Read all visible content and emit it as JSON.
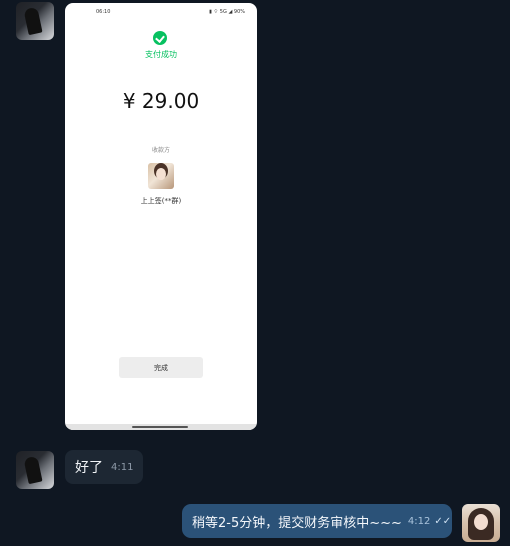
{
  "phone": {
    "status_time": "06:10",
    "status_right": "▮ ⌔ 5G ◢ 90%",
    "pay_success": "支付成功",
    "amount": "¥ 29.00",
    "payee_label": "收款方",
    "payee_name": "上上签(**群)",
    "done_label": "完成"
  },
  "messages": [
    {
      "text": "好了",
      "time": "4:11",
      "direction": "incoming"
    },
    {
      "text": "稍等2-5分钟，提交财务审核中~~~",
      "time": "4:12",
      "direction": "outgoing",
      "status": "read"
    }
  ],
  "icons": {
    "read": "✓✓"
  }
}
